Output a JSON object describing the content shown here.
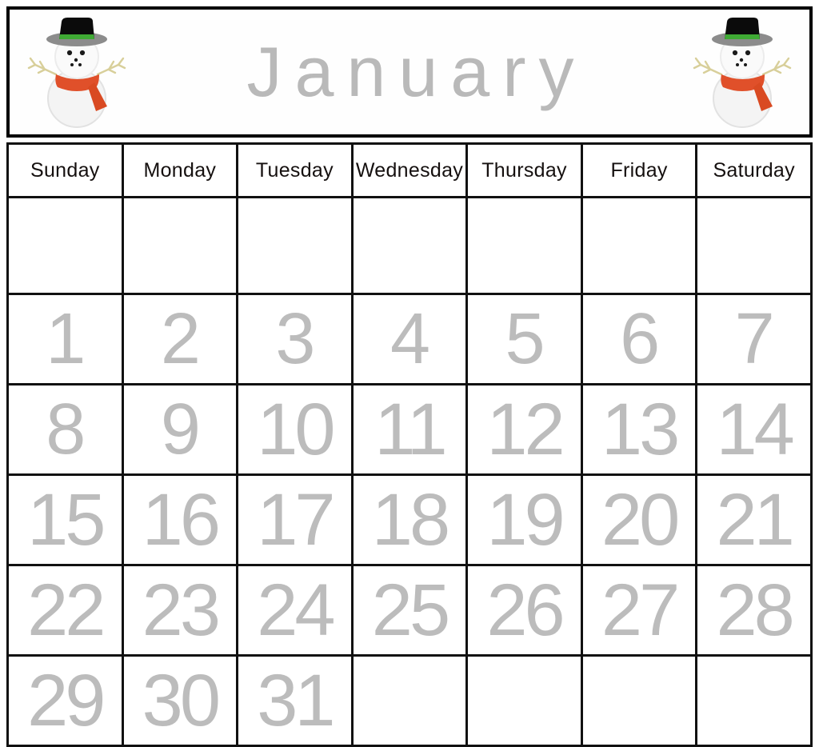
{
  "header": {
    "month_title": "January",
    "left_icon": "snowman-icon",
    "right_icon": "snowman-icon"
  },
  "calendar": {
    "weekday_headers": [
      "Sunday",
      "Monday",
      "Tuesday",
      "Wednesday",
      "Thursday",
      "Friday",
      "Saturday"
    ],
    "weeks": [
      [
        "",
        "",
        "",
        "",
        "",
        "",
        ""
      ],
      [
        "1",
        "2",
        "3",
        "4",
        "5",
        "6",
        "7"
      ],
      [
        "8",
        "9",
        "10",
        "11",
        "12",
        "13",
        "14"
      ],
      [
        "15",
        "16",
        "17",
        "18",
        "19",
        "20",
        "21"
      ],
      [
        "22",
        "23",
        "24",
        "25",
        "26",
        "27",
        "28"
      ],
      [
        "29",
        "30",
        "31",
        "",
        "",
        "",
        ""
      ]
    ]
  },
  "colors": {
    "grid_line": "#111111",
    "weekday_text": "#15100f",
    "day_number_text": "#bcbcbc",
    "month_title_text": "#b9b9b9",
    "page_background": "#ffffff",
    "snowman_hat": "#0b0b0b",
    "snowman_hat_brim": "#8c8c8c",
    "snowman_hat_band": "#3faa34",
    "snowman_body": "#f4f4f4",
    "snowman_scarf": "#e0502a",
    "snowman_arms": "#d8cf9a",
    "snowman_face": "#1a1a1a"
  }
}
